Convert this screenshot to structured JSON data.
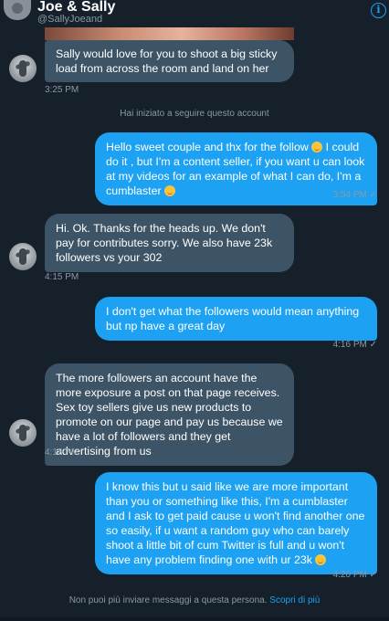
{
  "header": {
    "title": "Joe & Sally",
    "handle": "@SallyJoeand"
  },
  "system": {
    "follow_notice": "Hai iniziato a seguire questo account",
    "footer_notice": "Non puoi più inviare messaggi a questa persona.",
    "footer_link": "Scopri di più"
  },
  "messages": [
    {
      "from": "them",
      "text": "Sally would love for you to shoot a big sticky load from across the room and land on her",
      "time": "3:25 PM"
    },
    {
      "from": "me",
      "text_before": "Hello sweet couple and thx for the follow ",
      "text_mid": " I could do it , but I'm a content seller, if you want u can look at my videos for an example of what I can do, I'm  a cumblaster ",
      "emoji_1": "smiling-face-emoji",
      "emoji_2": "smirking-face-emoji",
      "time": "3:54 PM"
    },
    {
      "from": "them",
      "text": "Hi. Ok. Thanks for the heads up. We don't pay for contributes sorry. We also have 23k followers vs your 302",
      "time": "4:15 PM"
    },
    {
      "from": "me",
      "text": "I don't get what the followers would mean anything but np have a great day",
      "time": "4:16 PM"
    },
    {
      "from": "them",
      "text": "The more followers an account have the more exposure a post on that page receives. Sex toy sellers give us new products to promote on our page and pay us because we have a lot of followers and they get advertising from us",
      "time": "4:18 PM"
    },
    {
      "from": "me",
      "text": "I know this but u said like we are more important than you or something like this, I'm a cumblaster and I ask to get paid cause u won't find another one so easily, if u want a random guy who can barely shoot a little bit of cum Twitter is full and u won't have any problem finding one with ur 23k ",
      "emoji": "smirking-face-emoji",
      "time": "4:20 PM"
    }
  ],
  "icons": {
    "info": "info-icon",
    "read_check": "✓"
  },
  "colors": {
    "background": "#15202b",
    "incoming_bubble": "#3d5466",
    "outgoing_bubble": "#1da1f2",
    "muted_text": "#8899a6",
    "link": "#1da1f2"
  }
}
